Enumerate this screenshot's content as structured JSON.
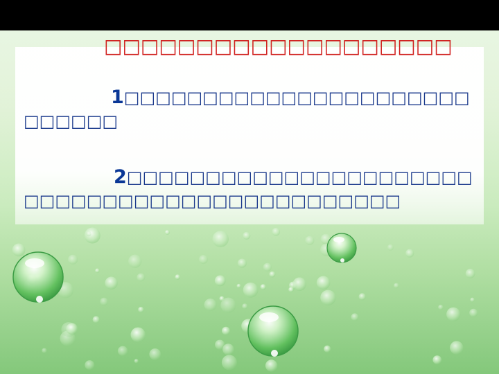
{
  "slide": {
    "title": "□□□□□□□□□□□□□□□□□□□",
    "items": [
      {
        "number": "1",
        "lines": [
          "□□□□□□□□□□□□□□□□□□□□□□",
          "□□□□□□"
        ]
      },
      {
        "number": "2",
        "lines": [
          "□□□□□□□□□□□□□□□□□□□□□□",
          "□□□□□□□□□□□□□□□□□□□□□□□□"
        ]
      }
    ]
  },
  "colors": {
    "title": "#d0201e",
    "body_text": "#1b3a8c",
    "top_bar": "#000000",
    "backdrop_green": "#8fcd86"
  },
  "icons": [
    "water-drop-icon"
  ]
}
